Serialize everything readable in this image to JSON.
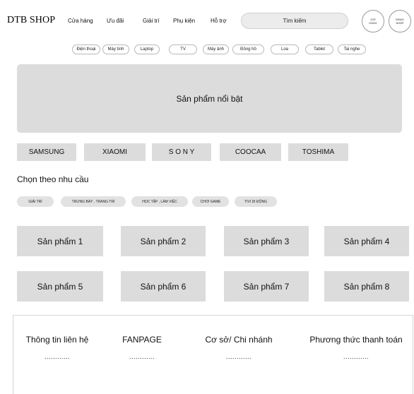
{
  "header": {
    "logo": "DTB SHOP",
    "nav": [
      "Cửa hàng",
      "Ưu đãi",
      "Giải trí",
      "Phụ kiện",
      "Hỗ trợ"
    ],
    "search_label": "Tìm kiếm",
    "cart_label": "GIỎ\nHÀNG",
    "login_label": "ĐĂNG\nNHẬP"
  },
  "categories": [
    "Điện thoại",
    "Máy tính",
    "Laptop",
    "TV",
    "Máy ảnh",
    "Đồng hồ",
    "Loa",
    "Tablet",
    "Tai nghe"
  ],
  "hero": {
    "title": "Sản phẩm nổi bật"
  },
  "brands": [
    "SAMSUNG",
    "XIAOMI",
    "S O N Y",
    "COOCAA",
    "TOSHIMA"
  ],
  "needs": {
    "title": "Chọn theo nhu cầu",
    "items": [
      "GIẢI TRÍ",
      "TRƯNG BÀY , TRANG TRÍ",
      "HỌC TẬP , LÀM VIỆC",
      "CHƠI GAME",
      "TIVI DI ĐỘNG"
    ]
  },
  "products": [
    "Sản phẩm 1",
    "Sản phẩm 2",
    "Sản phẩm 3",
    "Sản phẩm 4",
    "Sản phẩm 5",
    "Sản phẩm 6",
    "Sản phẩm 7",
    "Sản phẩm 8"
  ],
  "footer": {
    "columns": [
      {
        "title": "Thông tin liên hệ",
        "value": "............"
      },
      {
        "title": "FANPAGE",
        "value": "............"
      },
      {
        "title": "Cơ sở/ Chi nhánh",
        "value": "............"
      },
      {
        "title": "Phương thức thanh toán",
        "value": "............"
      }
    ]
  }
}
